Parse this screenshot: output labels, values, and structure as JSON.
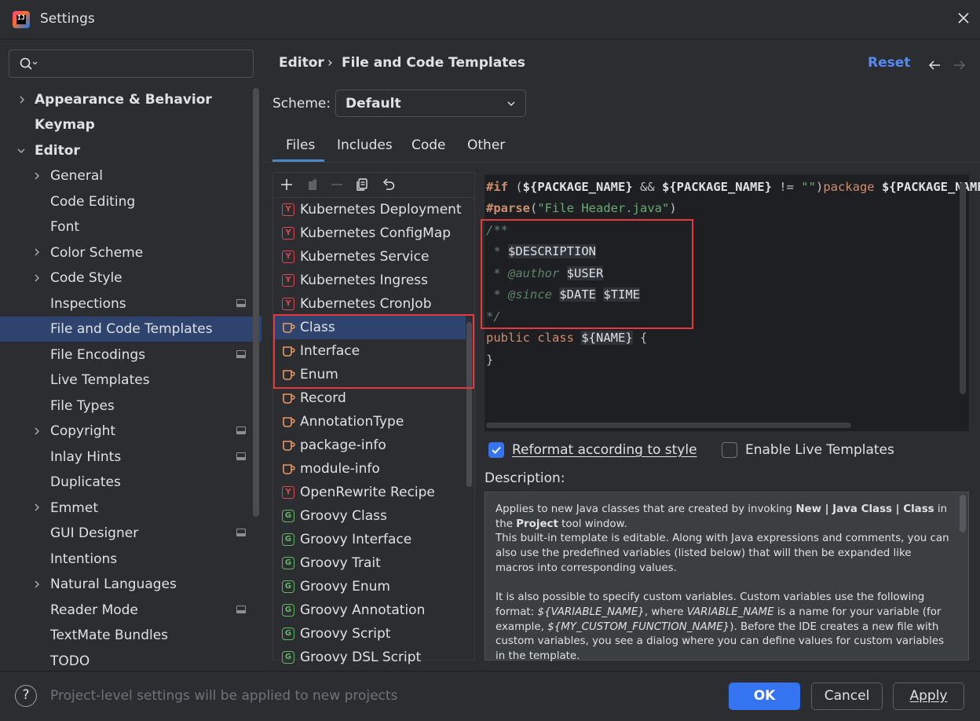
{
  "window": {
    "title": "Settings"
  },
  "search": {
    "placeholder": ""
  },
  "sidebar": {
    "items": [
      {
        "label": "Appearance & Behavior"
      },
      {
        "label": "Keymap"
      },
      {
        "label": "Editor"
      },
      {
        "label": "General"
      },
      {
        "label": "Code Editing"
      },
      {
        "label": "Font"
      },
      {
        "label": "Color Scheme"
      },
      {
        "label": "Code Style"
      },
      {
        "label": "Inspections"
      },
      {
        "label": "File and Code Templates"
      },
      {
        "label": "File Encodings"
      },
      {
        "label": "Live Templates"
      },
      {
        "label": "File Types"
      },
      {
        "label": "Copyright"
      },
      {
        "label": "Inlay Hints"
      },
      {
        "label": "Duplicates"
      },
      {
        "label": "Emmet"
      },
      {
        "label": "GUI Designer"
      },
      {
        "label": "Intentions"
      },
      {
        "label": "Natural Languages"
      },
      {
        "label": "Reader Mode"
      },
      {
        "label": "TextMate Bundles"
      },
      {
        "label": "TODO"
      }
    ]
  },
  "header": {
    "breadcrumb_parent": "Editor",
    "breadcrumb_sep": "›",
    "breadcrumb_current": "File and Code Templates",
    "reset": "Reset"
  },
  "scheme": {
    "label": "Scheme:",
    "value": "Default"
  },
  "tabs": [
    {
      "label": "Files"
    },
    {
      "label": "Includes"
    },
    {
      "label": "Code"
    },
    {
      "label": "Other"
    }
  ],
  "templates": [
    {
      "name": "Kubernetes Deployment",
      "icon": "yaml-icon"
    },
    {
      "name": "Kubernetes ConfigMap",
      "icon": "yaml-icon"
    },
    {
      "name": "Kubernetes Service",
      "icon": "yaml-icon"
    },
    {
      "name": "Kubernetes Ingress",
      "icon": "yaml-icon"
    },
    {
      "name": "Kubernetes CronJob",
      "icon": "yaml-icon"
    },
    {
      "name": "Class",
      "icon": "java-icon"
    },
    {
      "name": "Interface",
      "icon": "java-icon"
    },
    {
      "name": "Enum",
      "icon": "java-icon"
    },
    {
      "name": "Record",
      "icon": "java-icon"
    },
    {
      "name": "AnnotationType",
      "icon": "java-icon"
    },
    {
      "name": "package-info",
      "icon": "java-icon"
    },
    {
      "name": "module-info",
      "icon": "java-icon"
    },
    {
      "name": "OpenRewrite Recipe",
      "icon": "yaml-icon"
    },
    {
      "name": "Groovy Class",
      "icon": "groovy-icon"
    },
    {
      "name": "Groovy Interface",
      "icon": "groovy-icon"
    },
    {
      "name": "Groovy Trait",
      "icon": "groovy-icon"
    },
    {
      "name": "Groovy Enum",
      "icon": "groovy-icon"
    },
    {
      "name": "Groovy Annotation",
      "icon": "groovy-icon"
    },
    {
      "name": "Groovy Script",
      "icon": "groovy-icon"
    },
    {
      "name": "Groovy DSL Script",
      "icon": "groovy-icon"
    }
  ],
  "icon_letters": {
    "yaml": "Y",
    "groovy": "G"
  },
  "code": {
    "l1": {
      "a": "#if",
      "b": " (",
      "c": "${PACKAGE_NAME}",
      "d": " && ",
      "e": "${PACKAGE_NAME}",
      "f": " != ",
      "g": "\"\"",
      "h": ")",
      "i": "package ",
      "j": "${PACKAGE_NAME}"
    },
    "l2": {
      "a": "#parse",
      "b": "(",
      "c": "\"File Header.java\"",
      "d": ")"
    },
    "l3": "/**",
    "l4": {
      "a": " * ",
      "b": "$DESCRIPTION"
    },
    "l5": {
      "a": " * ",
      "b": "@author",
      "c": " ",
      "d": "$USER"
    },
    "l6": {
      "a": " * ",
      "b": "@since",
      "c": " ",
      "d": "$DATE",
      "e": " ",
      "f": "$TIME"
    },
    "l7": "*/",
    "l8": {
      "a": "public class ",
      "b": "${NAME}",
      "c": " {"
    },
    "l9": "}"
  },
  "options": {
    "reformat": "Reformat according to style",
    "reformat_checked": true,
    "live_templates": "Enable Live Templates",
    "live_templates_checked": false
  },
  "description": {
    "label": "Description:",
    "p1a": "Applies to new Java classes that are created by invoking ",
    "p1b": "New | Java Class | Class",
    "p1c": " in the ",
    "p1d": "Project",
    "p1e": " tool window.",
    "p2": "This built-in template is editable. Along with Java expressions and comments, you can also use the predefined variables (listed below) that will then be expanded like macros into corresponding values.",
    "p3a": "It is also possible to specify custom variables. Custom variables use the following format: ",
    "p3b": "${VARIABLE_NAME}",
    "p3c": ", where ",
    "p3d": "VARIABLE_NAME",
    "p3e": " is a name for your variable (for example, ",
    "p3f": "${MY_CUSTOM_FUNCTION_NAME}",
    "p3g": "). Before the IDE creates a new file with custom variables, you see a dialog where you can define values for custom variables in the template."
  },
  "footer": {
    "help": "?",
    "note": "Project-level settings will be applied to new projects",
    "ok": "OK",
    "cancel": "Cancel",
    "apply": "Apply"
  },
  "colors": {
    "accent": "#3574f0",
    "selection": "#2e436e",
    "highlight_box": "#e5393f",
    "link": "#548af7"
  }
}
